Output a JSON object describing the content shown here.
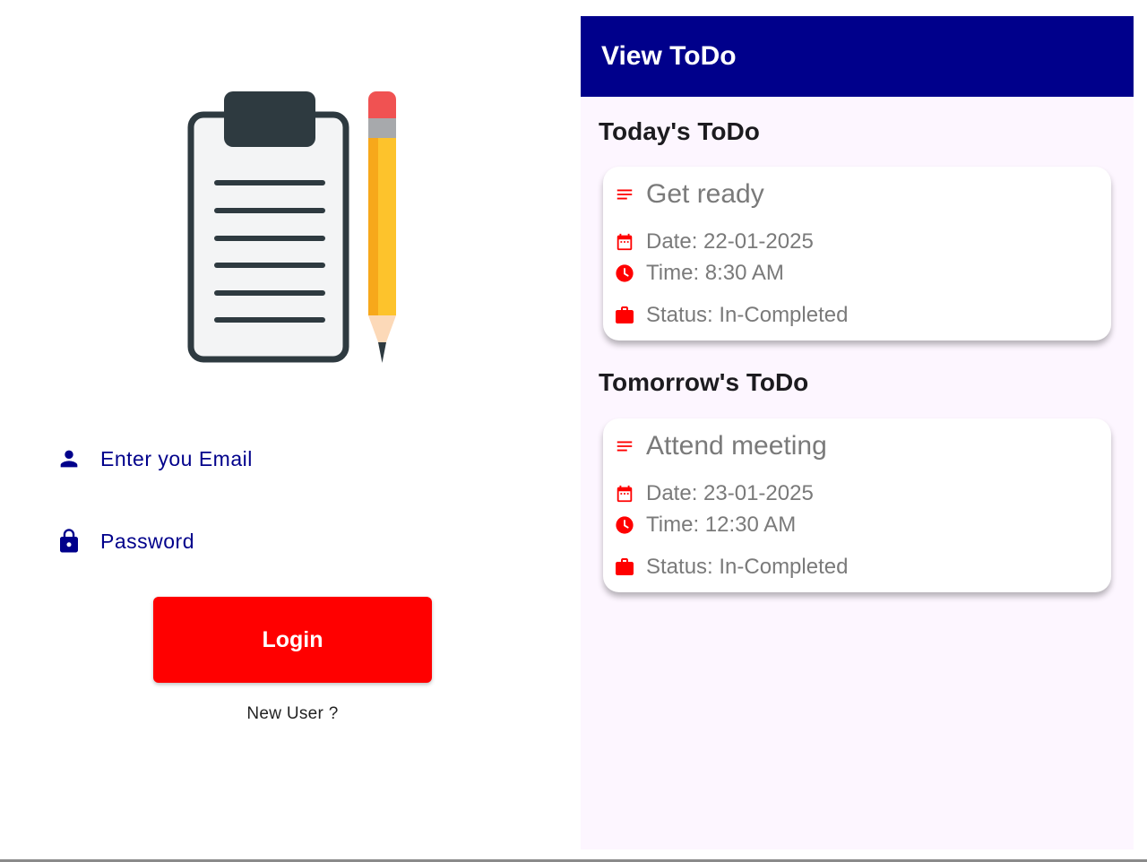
{
  "login": {
    "email_placeholder": "Enter you Email",
    "password_placeholder": "Password",
    "login_label": "Login",
    "new_user_label": "New User ?"
  },
  "todo": {
    "app_bar_title": "View ToDo",
    "sections": [
      {
        "heading": "Today's ToDo",
        "item": {
          "title": "Get ready",
          "date": "Date: 22-01-2025",
          "time": "Time: 8:30 AM",
          "status": "Status: In-Completed"
        }
      },
      {
        "heading": "Tomorrow's ToDo",
        "item": {
          "title": "Attend meeting",
          "date": "Date: 23-01-2025",
          "time": "Time: 12:30 AM",
          "status": "Status: In-Completed"
        }
      }
    ]
  },
  "icons": {
    "logo": "clipboard-pencil-icon",
    "email": "person-icon",
    "password": "lock-icon",
    "title": "notes-icon",
    "date": "calendar-icon",
    "time": "clock-icon",
    "status": "briefcase-icon"
  },
  "colors": {
    "primary": "#00008b",
    "accent": "#ff0000",
    "todo_background": "#fdf6ff",
    "card_text": "#7a7a7a"
  }
}
